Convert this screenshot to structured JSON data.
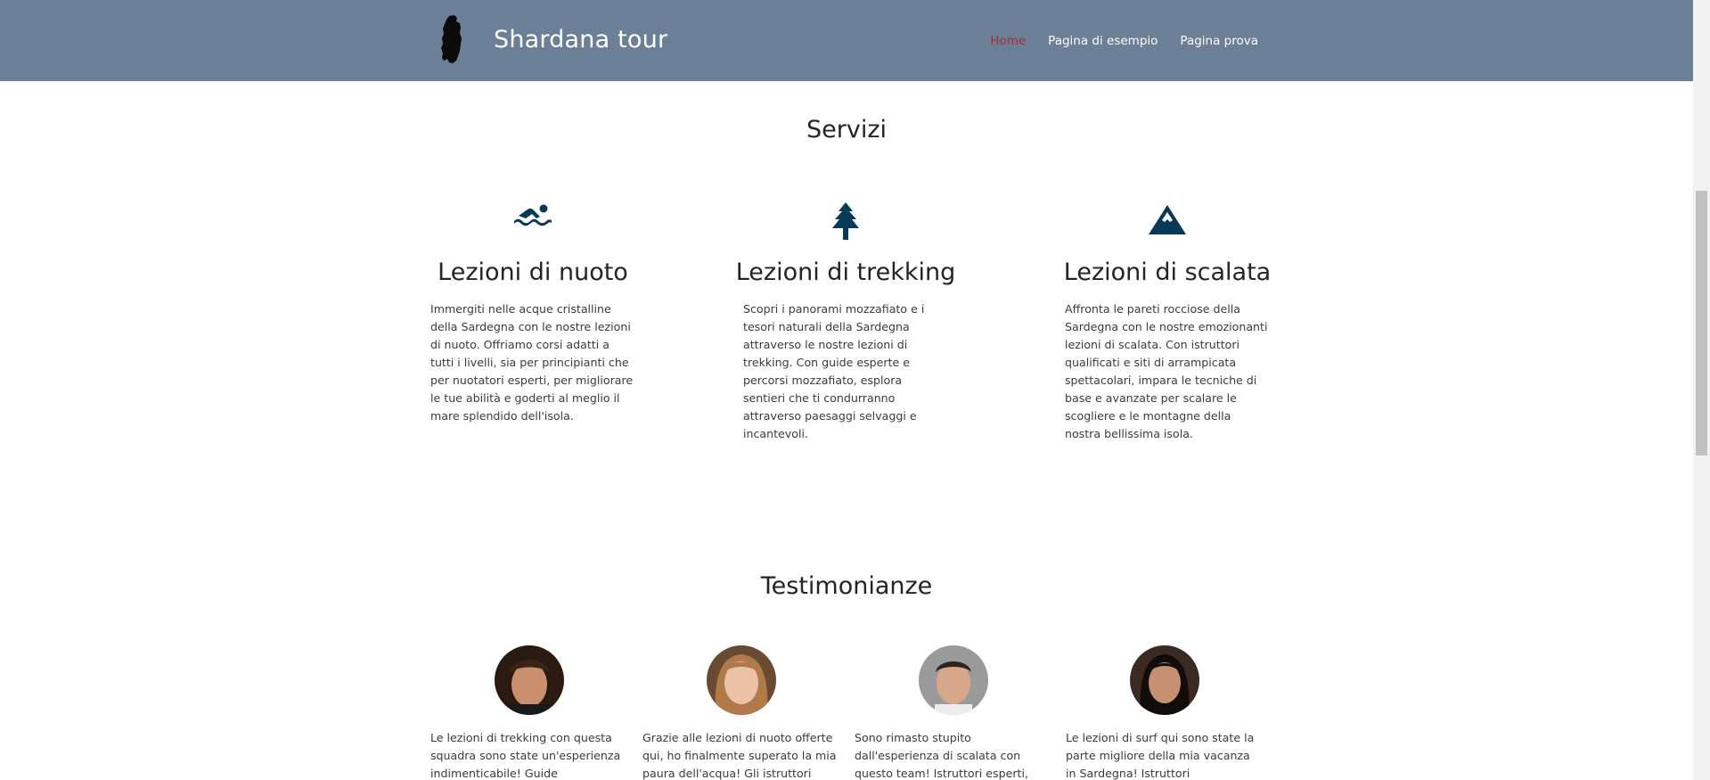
{
  "navbar": {
    "brand": "Shardana tour",
    "links": [
      "Home",
      "Pagina di esempio",
      "Pagina prova"
    ],
    "colors": {
      "background": "#6b7f96",
      "active_link": "#b02a37"
    }
  },
  "services": {
    "title": "Servizi",
    "items": [
      {
        "icon": "swimmer-icon",
        "title": "Lezioni di nuoto",
        "text": "Immergiti nelle acque cristalline della Sardegna con le nostre lezioni di nuoto. Offriamo corsi adatti a tutti i livelli, sia per principianti che per nuotatori esperti, per migliorare le tue abilità e goderti al meglio il mare splendido dell'isola."
      },
      {
        "icon": "tree-icon",
        "title": "Lezioni di trekking",
        "text": "Scopri i panorami mozzafiato e i tesori naturali della Sardegna attraverso le nostre lezioni di trekking. Con guide esperte e percorsi mozzafiato, esplora sentieri che ti condurranno attraverso paesaggi selvaggi e incantevoli."
      },
      {
        "icon": "mountain-icon",
        "title": "Lezioni di scalata",
        "text": "Affronta le pareti rocciose della Sardegna con le nostre emozionanti lezioni di scalata. Con istruttori qualificati e siti di arrampicata spettacolari, impara le tecniche di base e avanzate per scalare le scogliere e le montagne della nostra bellissima isola."
      }
    ],
    "icon_color": "#063a57"
  },
  "testimonials": {
    "title": "Testimonianze",
    "items": [
      {
        "text": "Le lezioni di trekking con questa squadra sono state un'esperienza indimenticabile! Guide competenti,"
      },
      {
        "text": "Grazie alle lezioni di nuoto offerte qui, ho finalmente superato la mia paura dell'acqua! Gli istruttori sono"
      },
      {
        "text": "Sono rimasto stupito dall'esperienza di scalata con questo team! Istruttori esperti, attrezzatura di qualità e"
      },
      {
        "text": "Le lezioni di surf qui sono state la parte migliore della mia vacanza in Sardegna! Istruttori appassionati e"
      }
    ]
  }
}
